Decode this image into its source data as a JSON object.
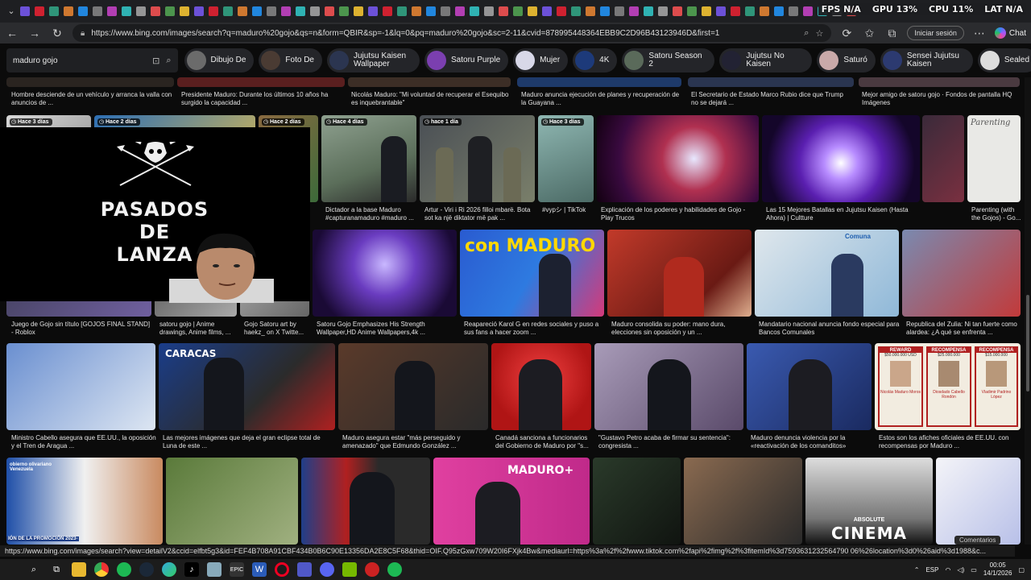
{
  "hud": {
    "fps": "FPS N/A",
    "gpu": "GPU 13%",
    "cpu": "CPU 11%",
    "lat": "LAT N/A"
  },
  "address": {
    "url": "https://www.bing.com/images/search?q=maduro%20gojo&qs=n&form=QBIR&sp=-1&lq=0&pq=maduro%20gojo&sc=2-11&cvid=878995448364EBB9C2D96B43123946D&first=1",
    "signin": "Iniciar sesión",
    "chat": "Chat"
  },
  "search": {
    "query": "maduro gojo"
  },
  "chips": [
    {
      "label": "Dibujo De",
      "color": "#6b6b6b"
    },
    {
      "label": "Foto De",
      "color": "#4a3b33"
    },
    {
      "label": "Jujutsu Kaisen Wallpaper",
      "color": "#2b3550"
    },
    {
      "label": "Satoru Purple",
      "color": "#7b3fb0"
    },
    {
      "label": "Mujer",
      "color": "#d8d8e8"
    },
    {
      "label": "4K",
      "color": "#1d3a7a"
    },
    {
      "label": "Satoru Season 2",
      "color": "#5a6a5a"
    },
    {
      "label": "Jujutsu No Kaisen",
      "color": "#222233"
    },
    {
      "label": "Saturó",
      "color": "#c9a9a9"
    },
    {
      "label": "Sensei Jujutsu Kaisen",
      "color": "#2c3a70"
    },
    {
      "label": "Sealed",
      "color": "#ddd"
    }
  ],
  "row1_captions": [
    "Hombre desciende de un vehículo y arranca la valla con anuncios de ...",
    "Presidente Maduro: Durante los últimos 10 años ha surgido la capacidad ...",
    "Nicolás Maduro: \"Mi voluntad de recuperar el Esequibo es inquebrantable\"",
    "Maduro anuncia ejecución de planes y recuperación de la Guayana ...",
    "El Secretario de Estado Marco Rubio dice que Trump no se dejará ...",
    "Mejor amigo de satoru gojo · Fondos de pantalla HQ Imágenes"
  ],
  "row2": [
    {
      "badge": "Hace 3 días",
      "caption": ""
    },
    {
      "badge": "Hace 2 días",
      "caption": ""
    },
    {
      "badge": "Hace 2 días",
      "caption": ""
    },
    {
      "badge": "Hace 4 días",
      "caption": "Dictador a la base Maduro #capturanamaduro #maduro ..."
    },
    {
      "badge": "hace 1 día",
      "caption": "Artur - Viri i Ri 2026 filloi mbarë. Bota sot ka një diktator më pak ..."
    },
    {
      "badge": "Hace 3 días",
      "caption": "#vypシ | TikTok"
    },
    {
      "badge": "",
      "caption": "Explicación de los poderes y habilidades de Gojo - Play Trucos"
    },
    {
      "badge": "",
      "caption": "Las 15 Mejores Batallas en Jujutsu Kaisen (Hasta Ahora) | Cultture"
    },
    {
      "badge": "",
      "caption": "Parenting (with the Gojos) - Go..."
    }
  ],
  "row3_captions": [
    "Juego de Gojo sin título [GOJOS FINAL STAND] - Roblox",
    "satoru gojo | Anime drawings, Anime films, ...",
    "Gojo Satoru art by haekz_ on X Twitte...",
    "Satoru Gojo Emphasizes His Strength Wallpaper,HD Anime Wallpapers,4k ...",
    "Reapareció Karol G en redes sociales y puso a sus fans a hacer zoom ...",
    "Maduro consolida su poder: mano dura, elecciones sin oposición y un ...",
    "Mandatario nacional anuncia fondo especial para Bancos Comunales",
    "Republica del Zulia: Ni tan fuerte como alardea: ¿A qué se enfrenta ..."
  ],
  "row4_captions": [
    "Ministro Cabello asegura que EE.UU., la oposición y el Tren de Aragua ...",
    "Las mejores imágenes que deja el gran eclipse total de Luna de este ...",
    "Maduro asegura estar \"más perseguido y amenazado\" que Edmundo González ...",
    "Canadá sanciona a funcionarios del Gobierno de Maduro por \"s...",
    "\"Gustavo Petro acaba de firmar su sentencia\": congresista ...",
    "Maduro denuncia violencia por la «reactivación de los comanditos»",
    "Estos son los afiches oficiales de EE.UU. con recompensas por Maduro ..."
  ],
  "row3_text": {
    "maduro_logo": "con MADURO",
    "comuna": "Comuna"
  },
  "row4_text": {
    "caracas": "CARACAS",
    "reward": "REWARD",
    "recompensa1": "RECOMPENSA",
    "recompensa2": "RECOMPENSA",
    "r1": "$50.000.000 USD",
    "r2": "$25.000.000",
    "r3": "$15.000.000",
    "n1": "Nicolás Maduro Moros",
    "n2": "Diosdado Cabello Rondón",
    "n3": "Vladimir Padrino López"
  },
  "row5_text": {
    "cinema1": "ABSOLUTE",
    "cinema2": "CINEMA",
    "maduro_plus": "MADURO+",
    "promo": "IÓN DE LA PROMOCIÓN 2023-",
    "gobierno": "obierno olivariano Venezuela"
  },
  "overlay": {
    "title_line1": "PASADOS",
    "title_line2": "DE",
    "title_line3": "LANZA"
  },
  "status_url": "https://www.bing.com/images/search?view=detailV2&ccid=elfbt5g3&id=FEF4B708A91CBF434B0B6C90E13356DA2E8C5F68&thid=OIF.Q95zGxw709W20I6FXjk4Bw&mediaurl=https%3a%2f%2fwww.tiktok.com%2fapi%2fimg%2f%3fitemId%3d7593631232564790 06%26location%3d0%26aid%3d1988&c...",
  "comments": "Comentarios",
  "tray": {
    "lang": "ESP",
    "time": "00:05",
    "date": "14/1/2026"
  }
}
